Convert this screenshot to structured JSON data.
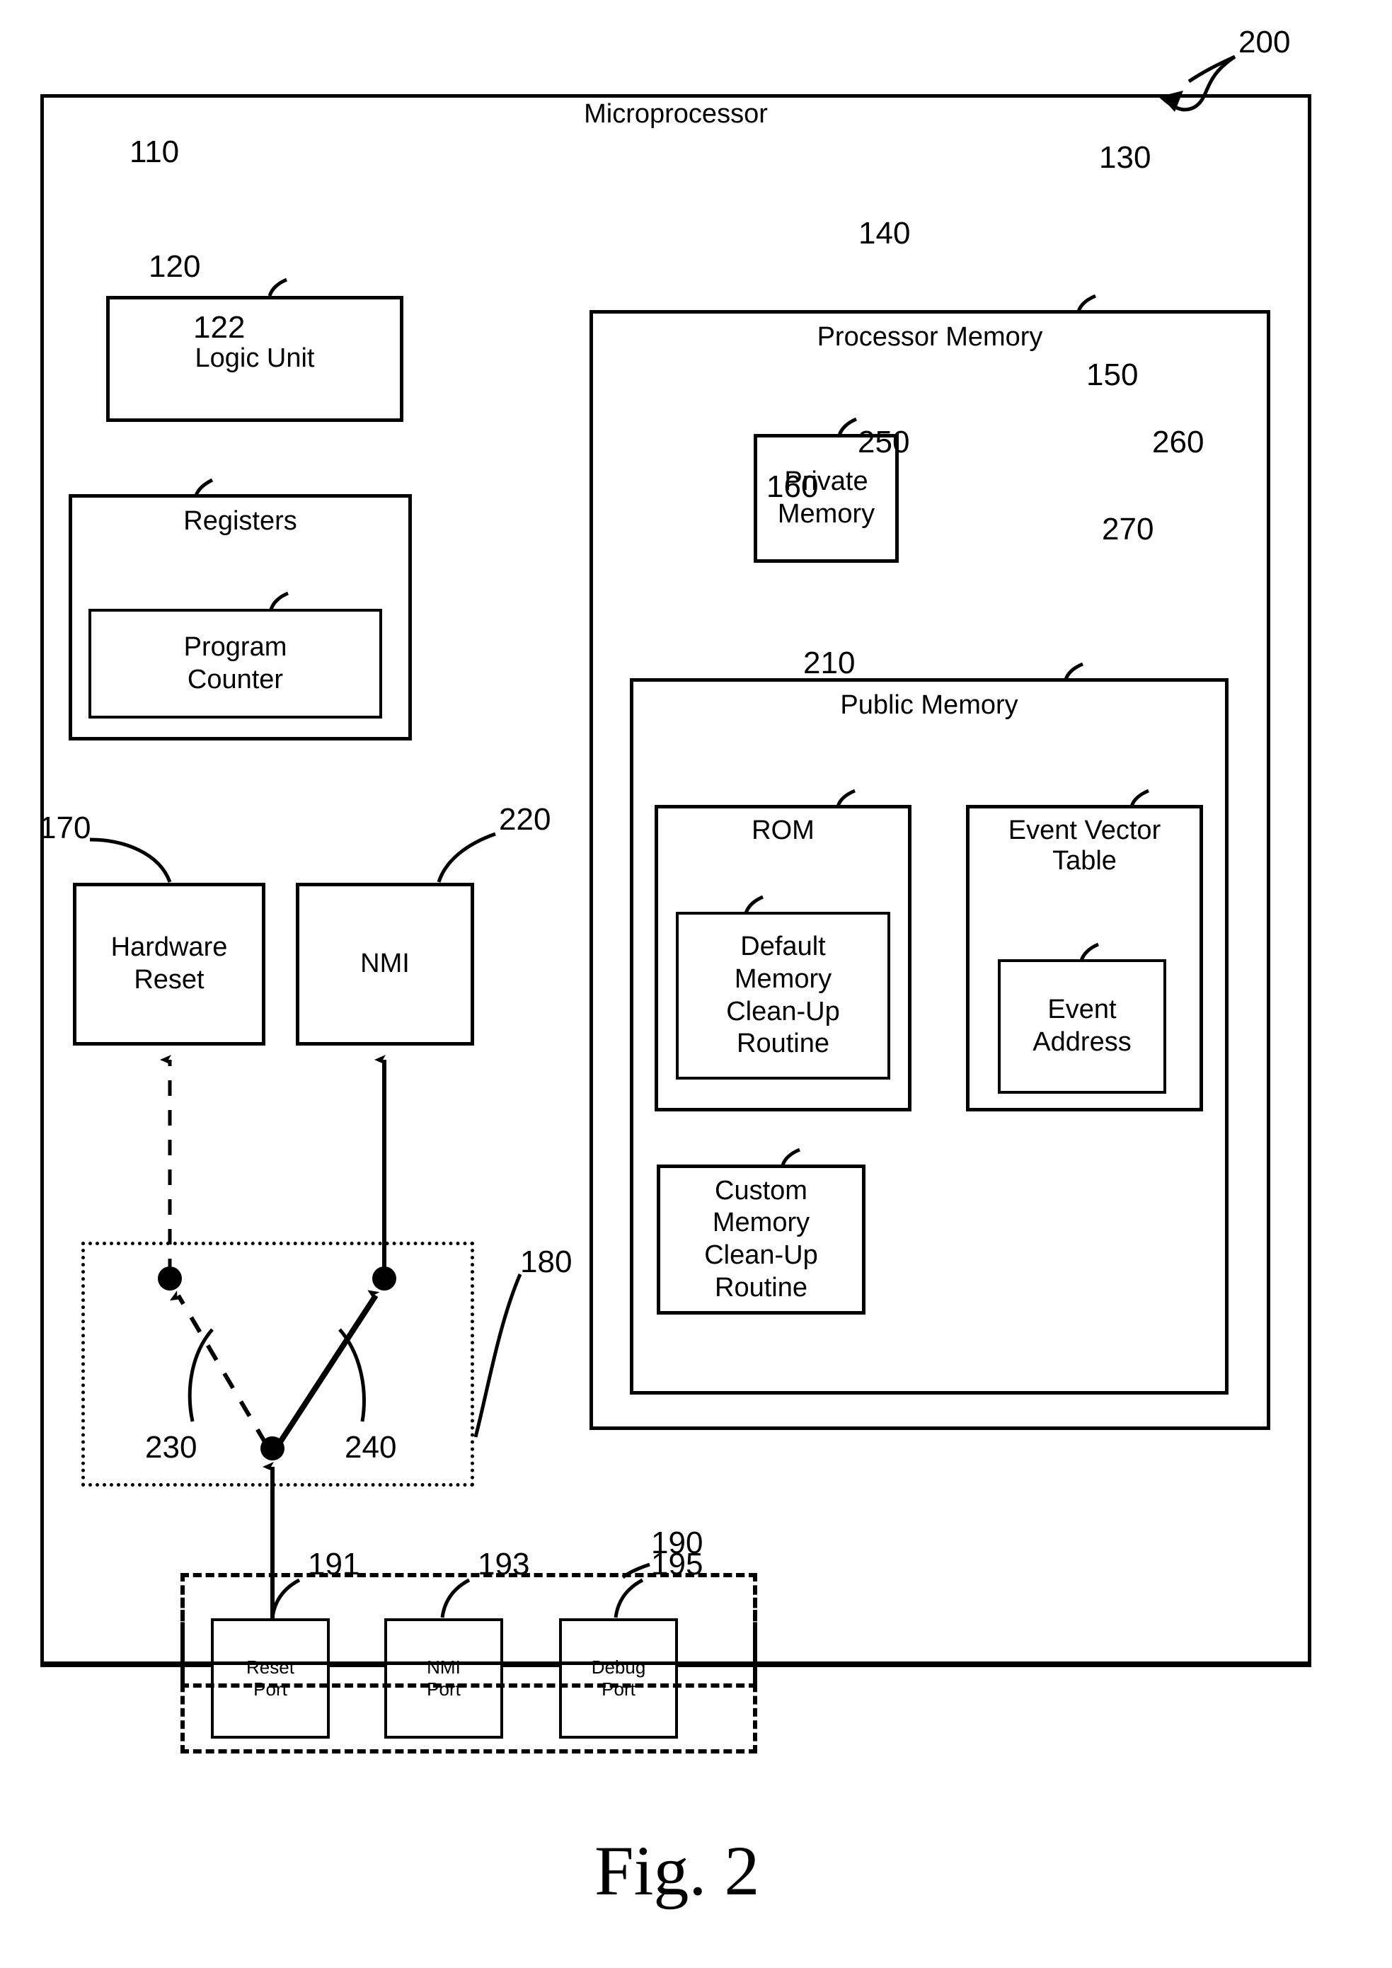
{
  "figure": {
    "caption": "Fig. 2",
    "main_reference": "200"
  },
  "microprocessor": {
    "title": "Microprocessor",
    "ref": "200",
    "logic_unit": {
      "label": "Logic Unit",
      "ref": "110"
    },
    "registers": {
      "label": "Registers",
      "ref": "120",
      "program_counter": {
        "label": "Program\nCounter",
        "ref": "122"
      }
    },
    "processor_memory": {
      "label": "Processor Memory",
      "ref": "130",
      "private_memory": {
        "label": "Private\nMemory",
        "ref": "140"
      },
      "public_memory": {
        "label": "Public Memory",
        "ref": "150",
        "rom": {
          "label": "ROM",
          "ref": "250",
          "default_routine": {
            "label": "Default\nMemory\nClean-Up\nRoutine",
            "ref": "160"
          }
        },
        "event_vector_table": {
          "label": "Event Vector\nTable",
          "ref": "260",
          "event_address": {
            "label": "Event\nAddress",
            "ref": "270"
          }
        },
        "custom_routine": {
          "label": "Custom\nMemory\nClean-Up\nRoutine",
          "ref": "210"
        }
      }
    },
    "hardware_reset": {
      "label": "Hardware\nReset",
      "ref": "170"
    },
    "nmi": {
      "label": "NMI",
      "ref": "220"
    },
    "signal_router": {
      "ref": "180",
      "path_dashed_ref": "230",
      "path_solid_ref": "240"
    }
  },
  "ports": {
    "ref": "190",
    "items": [
      {
        "label": "Reset\nPort",
        "ref": "191"
      },
      {
        "label": "NMI\nPort",
        "ref": "193"
      },
      {
        "label": "Debug\nPort",
        "ref": "195"
      }
    ]
  }
}
